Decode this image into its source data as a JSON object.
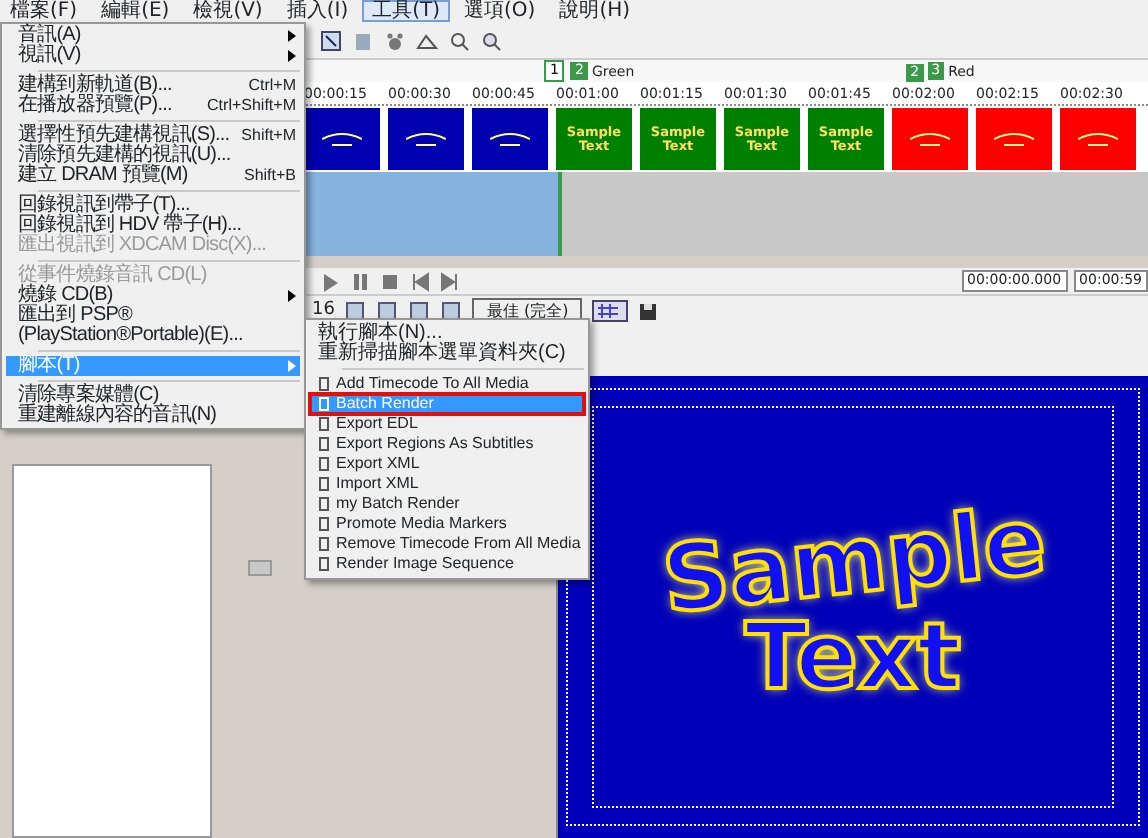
{
  "menubar": [
    {
      "label": "檔案(F)",
      "selected": false
    },
    {
      "label": "編輯(E)",
      "selected": false
    },
    {
      "label": "檢視(V)",
      "selected": false
    },
    {
      "label": "插入(I)",
      "selected": false
    },
    {
      "label": "工具(T)",
      "selected": true
    },
    {
      "label": "選項(O)",
      "selected": false
    },
    {
      "label": "說明(H)",
      "selected": false
    }
  ],
  "tools_menu": [
    {
      "kind": "item",
      "label": "音訊(A)",
      "submenu": true
    },
    {
      "kind": "item",
      "label": "視訊(V)",
      "submenu": true
    },
    {
      "kind": "separator"
    },
    {
      "kind": "item",
      "label": "建構到新軌道(B)...",
      "shortcut": "Ctrl+M"
    },
    {
      "kind": "item",
      "label": "在播放器預覽(P)...",
      "shortcut": "Ctrl+Shift+M"
    },
    {
      "kind": "separator"
    },
    {
      "kind": "item",
      "label": "選擇性預先建構視訊(S)...",
      "shortcut": "Shift+M"
    },
    {
      "kind": "item",
      "label": "清除預先建構的視訊(U)..."
    },
    {
      "kind": "item",
      "label": "建立 DRAM 預覽(M)",
      "shortcut": "Shift+B"
    },
    {
      "kind": "separator"
    },
    {
      "kind": "item",
      "label": "回錄視訊到帶子(T)..."
    },
    {
      "kind": "item",
      "label": "回錄視訊到 HDV 帶子(H)..."
    },
    {
      "kind": "item",
      "label": "匯出視訊到 XDCAM Disc(X)...",
      "disabled": true
    },
    {
      "kind": "separator"
    },
    {
      "kind": "item",
      "label": "從事件燒錄音訊 CD(L)",
      "disabled": true
    },
    {
      "kind": "item",
      "label": "燒錄 CD(B)",
      "submenu": true
    },
    {
      "kind": "item",
      "label": "匯出到 PSP® (PlayStation®Portable)(E)..."
    },
    {
      "kind": "separator"
    },
    {
      "kind": "item",
      "label": "腳本(T)",
      "submenu": true,
      "selected": true
    },
    {
      "kind": "separator"
    },
    {
      "kind": "item",
      "label": "清除專案媒體(C)"
    },
    {
      "kind": "item",
      "label": "重建離線內容的音訊(N)"
    }
  ],
  "script_menu": [
    {
      "kind": "item",
      "label": "執行腳本(N)..."
    },
    {
      "kind": "item",
      "label": "重新掃描腳本選單資料夾(C)"
    },
    {
      "kind": "separator"
    },
    {
      "kind": "script",
      "label": "Add Timecode To All Media",
      "selected": false
    },
    {
      "kind": "script",
      "label": "Batch Render",
      "selected": true
    },
    {
      "kind": "script",
      "label": "Export EDL",
      "selected": false
    },
    {
      "kind": "script",
      "label": "Export Regions As Subtitles",
      "selected": false
    },
    {
      "kind": "script",
      "label": "Export XML",
      "selected": false
    },
    {
      "kind": "script",
      "label": "Import XML",
      "selected": false
    },
    {
      "kind": "script",
      "label": "my Batch Render",
      "selected": false
    },
    {
      "kind": "script",
      "label": "Promote Media Markers",
      "selected": false
    },
    {
      "kind": "script",
      "label": "Remove Timecode From All Media",
      "selected": false
    },
    {
      "kind": "script",
      "label": "Render Image Sequence",
      "selected": false
    }
  ],
  "timeline": {
    "markers": [
      {
        "number": "1"
      },
      {
        "number": "2",
        "label": "Green"
      },
      {
        "number": "2"
      },
      {
        "number": "3",
        "label": "Red"
      }
    ],
    "ruler": [
      "00:00:15",
      "00:00:30",
      "00:00:45",
      "00:01:00",
      "00:01:15",
      "00:01:30",
      "00:01:45",
      "00:02:00",
      "00:02:15",
      "00:02:30"
    ],
    "clips": [
      {
        "color": "#0000b0"
      },
      {
        "color": "#0000b0"
      },
      {
        "color": "#0000b0"
      },
      {
        "color": "#008000",
        "text": "Sample Text"
      },
      {
        "color": "#008000",
        "text": "Sample Text"
      },
      {
        "color": "#008000",
        "text": "Sample Text"
      },
      {
        "color": "#008000",
        "text": "Sample Text"
      },
      {
        "color": "#ff0000"
      },
      {
        "color": "#ff0000"
      },
      {
        "color": "#ff0000"
      }
    ]
  },
  "transport": {
    "times": [
      "00:00:00.000",
      "00:00:59"
    ]
  },
  "preview_toolbar": {
    "frame": "16",
    "quality": "最佳 (完全)"
  },
  "preview": {
    "lines": [
      "Sample",
      "Text"
    ]
  }
}
